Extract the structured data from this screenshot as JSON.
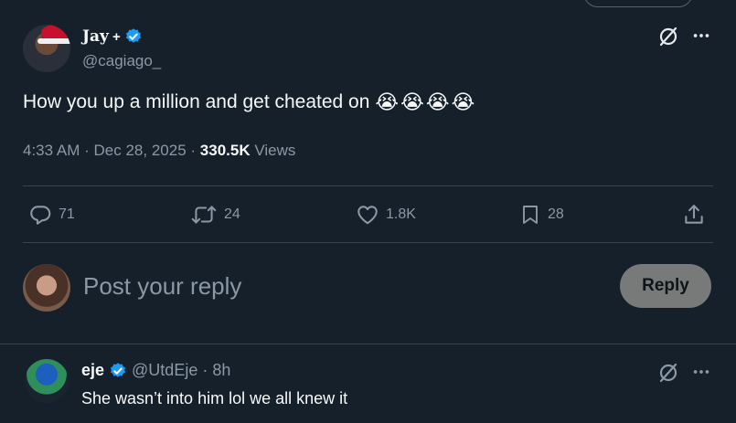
{
  "tweet": {
    "display_name": "Jay",
    "name_suffix": "+",
    "handle": "@cagiago_",
    "text": "How you up a million and get cheated on",
    "emojis": [
      "😭",
      "😭",
      "😭",
      "😭"
    ],
    "time": "4:33 AM",
    "date": "Dec 28, 2025",
    "views_count": "330.5K",
    "views_label": "Views",
    "separator": "·"
  },
  "actions": {
    "replies": "71",
    "reposts": "24",
    "likes": "1.8K",
    "bookmarks": "28"
  },
  "composer": {
    "placeholder": "Post your reply",
    "button_label": "Reply"
  },
  "reply": {
    "display_name": "eje",
    "handle": "@UtdEje",
    "separator": "·",
    "time": "8h",
    "text": "She wasn’t into him lol we all knew it"
  },
  "colors": {
    "background": "#15202b",
    "verified": "#1d9bf0",
    "muted_text": "#8b98a5",
    "divider": "#38444d",
    "reply_button_bg": "#787a7a"
  }
}
